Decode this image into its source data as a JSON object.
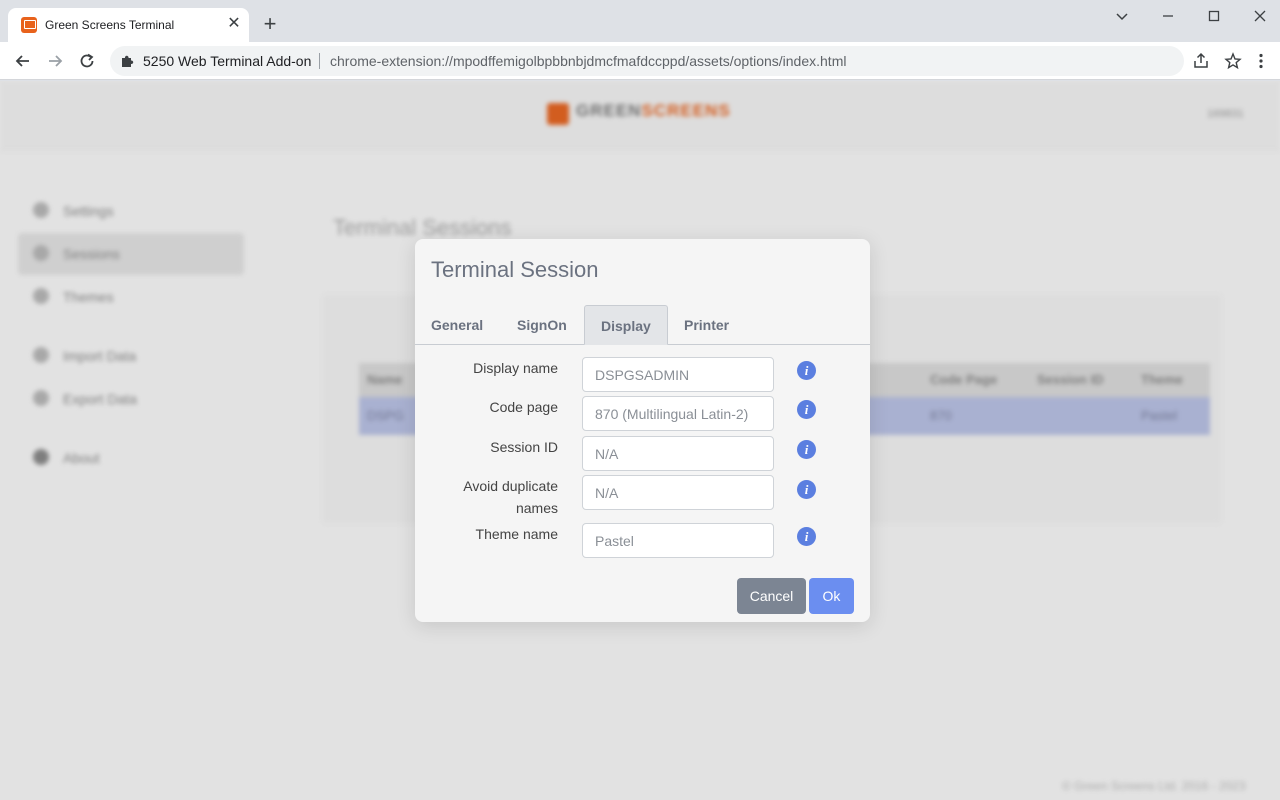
{
  "browser": {
    "tab_title": "Green Screens Terminal",
    "tab_close": "✕",
    "new_tab": "+",
    "extension_name": "5250 Web Terminal Add-on",
    "url": "chrome-extension://mpodffemigolbpbbnbjdmcfmafdccppd/assets/options/index.html"
  },
  "app": {
    "logo_part1": "GREEN",
    "logo_part2": "SCREENS",
    "header_right": "169831",
    "sidebar": [
      {
        "label": "Settings",
        "icon": "gear-icon"
      },
      {
        "label": "Sessions",
        "icon": "monitor-icon"
      },
      {
        "label": "Themes",
        "icon": "eye-icon"
      },
      {
        "label": "Import Data",
        "icon": "upload-icon"
      },
      {
        "label": "Export Data",
        "icon": "download-icon"
      },
      {
        "label": "About",
        "icon": "info-icon"
      }
    ],
    "content_title": "Terminal Sessions",
    "table_headers": [
      "Name",
      "Code Page",
      "Session ID",
      "Theme"
    ],
    "table_row": [
      "DSPG",
      "870",
      "Pastel"
    ],
    "footer": "© Green Screens Ltd. 2016 - 2023"
  },
  "modal": {
    "title": "Terminal Session",
    "tabs": [
      {
        "label": "General",
        "active": false
      },
      {
        "label": "SignOn",
        "active": false
      },
      {
        "label": "Display",
        "active": true
      },
      {
        "label": "Printer",
        "active": false
      }
    ],
    "fields": [
      {
        "label": "Display name",
        "value": "DSPGSADMIN"
      },
      {
        "label": "Code page",
        "value": "870 (Multilingual Latin-2)"
      },
      {
        "label": "Session ID",
        "value": "N/A"
      },
      {
        "label_line1": "Avoid duplicate",
        "label_line2": "names",
        "value": "N/A"
      },
      {
        "label": "Theme name",
        "value": "Pastel"
      }
    ],
    "info_glyph": "i",
    "cancel_label": "Cancel",
    "ok_label": "Ok"
  },
  "colors": {
    "accent": "#6b8ef0",
    "brand": "#e8621c",
    "cancel": "#7c8593",
    "selected_row": "#b9c2e6"
  }
}
